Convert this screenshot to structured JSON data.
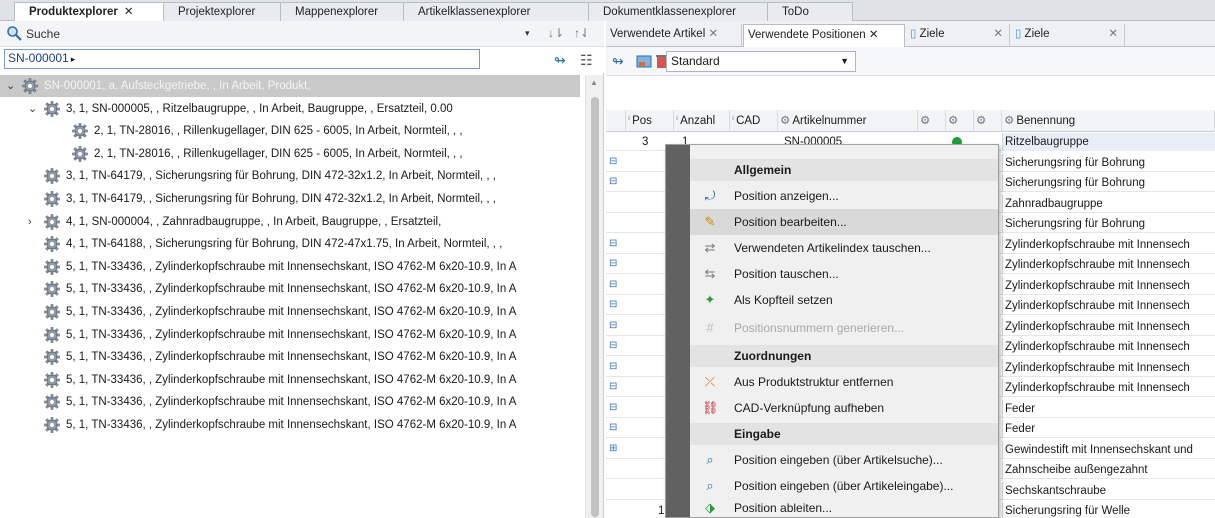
{
  "top_tabs": [
    {
      "label": "Produktexplorer",
      "close": "✕",
      "active": true
    },
    {
      "label": "Projektexplorer"
    },
    {
      "label": "Mappenexplorer"
    },
    {
      "label": "Artikelklassenexplorer"
    },
    {
      "label": "Dokumentklassenexplorer"
    },
    {
      "label": "ToDo"
    }
  ],
  "left": {
    "search_label": "Suche",
    "search_dropdown": "▾",
    "search_value": "SN-000001",
    "tree": [
      {
        "text": "SN-000001, a, Aufsteckgetriebe, , In Arbeit, Produkt,",
        "expander": "⌄"
      },
      {
        "text": "3, 1, SN-000005, , Ritzelbaugruppe, , In Arbeit, Baugruppe, , Ersatzteil, 0.00",
        "expander": "⌄"
      },
      {
        "text": "2, 1, TN-28016, , Rillenkugellager, DIN 625 - 6005, In Arbeit, Normteil, , ,"
      },
      {
        "text": "2, 1, TN-28016, , Rillenkugellager, DIN 625 - 6005, In Arbeit, Normteil, , ,"
      },
      {
        "text": "3, 1, TN-64179, , Sicherungsring für Bohrung, DIN 472-32x1.2, In Arbeit, Normteil, , ,"
      },
      {
        "text": "3, 1, TN-64179, , Sicherungsring für Bohrung, DIN 472-32x1.2, In Arbeit, Normteil, , ,"
      },
      {
        "text": "4, 1, SN-000004, , Zahnradbaugruppe, , In Arbeit, Baugruppe, , Ersatzteil,",
        "expander": "›"
      },
      {
        "text": "4, 1, TN-64188, , Sicherungsring für Bohrung, DIN 472-47x1.75, In Arbeit, Normteil, , ,"
      },
      {
        "text": "5, 1, TN-33436, , Zylinderkopfschraube mit Innensechskant, ISO 4762-M 6x20-10.9, In A"
      },
      {
        "text": "5, 1, TN-33436, , Zylinderkopfschraube mit Innensechskant, ISO 4762-M 6x20-10.9, In A"
      },
      {
        "text": "5, 1, TN-33436, , Zylinderkopfschraube mit Innensechskant, ISO 4762-M 6x20-10.9, In A"
      },
      {
        "text": "5, 1, TN-33436, , Zylinderkopfschraube mit Innensechskant, ISO 4762-M 6x20-10.9, In A"
      },
      {
        "text": "5, 1, TN-33436, , Zylinderkopfschraube mit Innensechskant, ISO 4762-M 6x20-10.9, In A"
      },
      {
        "text": "5, 1, TN-33436, , Zylinderkopfschraube mit Innensechskant, ISO 4762-M 6x20-10.9, In A"
      },
      {
        "text": "5, 1, TN-33436, , Zylinderkopfschraube mit Innensechskant, ISO 4762-M 6x20-10.9, In A"
      },
      {
        "text": "5, 1, TN-33436, , Zylinderkopfschraube mit Innensechskant, ISO 4762-M 6x20-10.9, In A"
      }
    ]
  },
  "right": {
    "tabs": [
      {
        "label": "Verwendete Artikel",
        "close": "✕"
      },
      {
        "label": "Verwendete Positionen",
        "close": "✕",
        "active": true
      },
      {
        "label": "Ziele",
        "close": "✕"
      },
      {
        "label": "Ziele",
        "close": "✕"
      }
    ],
    "view_select": "Standard",
    "columns": [
      "Pos",
      "Anzahl",
      "CAD",
      "Artikelnummer",
      "",
      "",
      "",
      "Benennung"
    ],
    "first_row": {
      "pos": "3",
      "anzahl": "1",
      "artikelnummer": "SN-000005"
    },
    "last_row_pos": "1",
    "benennung": [
      "Ritzelbaugruppe",
      "Sicherungsring für Bohrung",
      "Sicherungsring für Bohrung",
      "Zahnradbaugruppe",
      "Sicherungsring für Bohrung",
      "Zylinderkopfschraube mit Innensech",
      "Zylinderkopfschraube mit Innensech",
      "Zylinderkopfschraube mit Innensech",
      "Zylinderkopfschraube mit Innensech",
      "Zylinderkopfschraube mit Innensech",
      "Zylinderkopfschraube mit Innensech",
      "Zylinderkopfschraube mit Innensech",
      "Zylinderkopfschraube mit Innensech",
      "Feder",
      "Feder",
      "Gewindestift mit Innensechskant und",
      "Zahnscheibe außengezahnt",
      "Sechskantschraube",
      "Sicherungsring für Welle"
    ]
  },
  "context_menu": {
    "sections": {
      "allgemein": "Allgemein",
      "zuordnungen": "Zuordnungen",
      "eingabe": "Eingabe"
    },
    "items": {
      "position_anzeigen": "Position anzeigen...",
      "position_bearbeiten": "Position bearbeiten...",
      "artikelindex_tauschen": "Verwendeten Artikelindex tauschen...",
      "position_tauschen": "Position tauschen...",
      "kopfteil_setzen": "Als Kopfteil setzen",
      "positionsnummern": "Positionsnummern generieren...",
      "aus_struktur_entfernen": "Aus Produktstruktur entfernen",
      "cad_aufheben": "CAD-Verknüpfung aufheben",
      "eingeben_suche": "Position eingeben (über Artikelsuche)...",
      "eingeben_eingabe": "Position eingeben (über Artikeleingabe)...",
      "ableiten": "Position ableiten..."
    }
  },
  "colors": {
    "accent": "#3a6fb0",
    "highlight": "#d9d9d9",
    "menu_strip": "#616161",
    "status_green": "#1f9d3a"
  }
}
